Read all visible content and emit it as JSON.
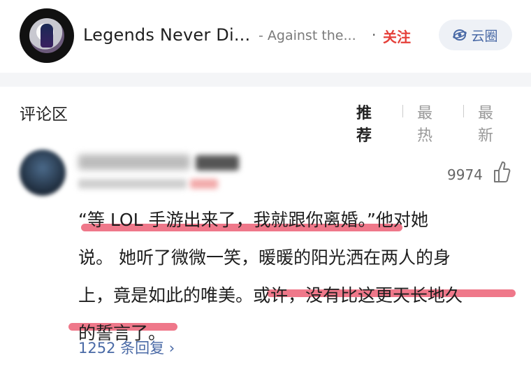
{
  "header": {
    "song_title": "Legends Never Di...",
    "artist": "- Against the...",
    "dot": "·",
    "follow_label": "关注",
    "circle_label": "云圈"
  },
  "comments_section": {
    "title": "评论区",
    "tabs": [
      {
        "label": "推荐",
        "active": true
      },
      {
        "label": "最热",
        "active": false
      },
      {
        "label": "最新",
        "active": false
      }
    ]
  },
  "comment": {
    "like_count": "9974",
    "text_lines": [
      "“等 LOL 手游出来了，我就跟你离婚。”他对她",
      "说。 她听了微微一笑，暖暖的阳光洒在两人的身",
      "上，竟是如此的唯美。或许，没有比这更天长地久",
      "的誓言了。"
    ],
    "replies_label": "1252 条回复 ›"
  },
  "colors": {
    "accent_red": "#e5403a",
    "link_blue": "#4a6aa6",
    "highlight": "#ee6d80"
  }
}
